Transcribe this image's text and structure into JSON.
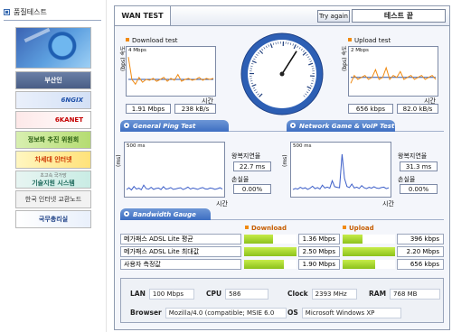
{
  "sidebar": {
    "heading": "품질테스트",
    "banners": {
      "busan": "부산인",
      "ngix": "6NGIX",
      "kanet": "6KANET",
      "info": "정보화 추진 위원회",
      "next": "차세대 인터넷",
      "kisti_sub": "초고속 국가망",
      "kisti": "기술지원 시스템",
      "kix": "한국 인터넷 교환노드",
      "pm": "국무총리실"
    }
  },
  "toolbar": {
    "title": "WAN TEST",
    "retry_label": "Try again",
    "status": "테스트 끝"
  },
  "download": {
    "label": "Download test",
    "yaxis": "(bps) 속도",
    "scale": "4 Mbps",
    "xlabel": "시간",
    "bps": "1.91 Mbps",
    "kBs": "238 kB/s",
    "series": [
      3.7,
      1.4,
      0.9,
      1.6,
      1.1,
      1.4,
      1.3,
      1.5,
      1.2,
      1.4,
      1.6,
      1.2,
      1.5,
      1.3,
      1.9,
      1.2,
      1.4,
      1.5,
      1.3,
      1.4,
      1.6,
      1.3,
      1.5,
      1.4,
      1.5
    ]
  },
  "upload": {
    "label": "Upload test",
    "yaxis": "(bps) 속도",
    "scale": "2 Mbps",
    "xlabel": "시간",
    "bps": "656 kbps",
    "kBs": "82.0 kB/s",
    "series": [
      0.5,
      0.9,
      0.7,
      0.8,
      0.9,
      0.7,
      0.8,
      1.2,
      0.7,
      0.8,
      1.3,
      0.7,
      0.9,
      0.8,
      1.1,
      0.7,
      0.8,
      0.9,
      0.7,
      0.8,
      0.9,
      0.7,
      0.8,
      0.9,
      0.7
    ]
  },
  "dial": {
    "needle_value": 0.62
  },
  "ping": {
    "tab": "General Ping Test",
    "yaxis": "(ms)",
    "scale": "500 ms",
    "xlabel": "시간",
    "rtt_label": "왕복지연율",
    "rtt_value": "22.7 ms",
    "loss_label": "손실율",
    "loss_value": "0.00%",
    "series": [
      20,
      28,
      18,
      34,
      22,
      26,
      19,
      40,
      24,
      22,
      30,
      21,
      25,
      27,
      20,
      33,
      22,
      24,
      29,
      21,
      23,
      26,
      28,
      20,
      25,
      31,
      22,
      27,
      24,
      21,
      26,
      29,
      23,
      22,
      27,
      25,
      21,
      24,
      28,
      22
    ]
  },
  "game": {
    "tab": "Network Game & VoIP Test",
    "yaxis": "(ms)",
    "scale": "500 ms",
    "xlabel": "시간",
    "rtt_label": "왕복지연율",
    "rtt_value": "31.3 ms",
    "loss_label": "손실율",
    "loss_value": "0.00%",
    "series": [
      20,
      25,
      22,
      30,
      24,
      28,
      21,
      26,
      35,
      24,
      29,
      22,
      40,
      27,
      31,
      26,
      60,
      33,
      30,
      28,
      180,
      70,
      34,
      29,
      45,
      27,
      31,
      25,
      38,
      28,
      24,
      30,
      26,
      33,
      27,
      25,
      29,
      31,
      24,
      28
    ]
  },
  "bandwidth": {
    "tab": "Bandwidth Gauge",
    "download_label": "Download",
    "upload_label": "Upload",
    "rows": [
      {
        "name": "메가패스 ADSL Lite 평균",
        "down": "1.36 Mbps",
        "down_frac": 0.55,
        "up": "396 kbps",
        "up_frac": 0.38
      },
      {
        "name": "메가패스 ADSL Lite 최대값",
        "down": "2.50 Mbps",
        "down_frac": 1.0,
        "up": "2.20 Mbps",
        "up_frac": 1.0
      },
      {
        "name": "사용자 측정값",
        "down": "1.90 Mbps",
        "down_frac": 0.76,
        "up": "656 kbps",
        "up_frac": 0.62
      }
    ]
  },
  "system": {
    "lan_key": "LAN",
    "lan_val": "100 Mbps",
    "cpu_key": "CPU",
    "cpu_val": "586",
    "clock_key": "Clock",
    "clock_val": "2393 MHz",
    "ram_key": "RAM",
    "ram_val": "768 MB",
    "browser_key": "Browser",
    "browser_val": "Mozilla/4.0 (compatible; MSIE 6.0",
    "os_key": "OS",
    "os_val": "Microsoft Windows XP"
  },
  "colors": {
    "download_line": "#f08a12",
    "upload_line": "#f08a12",
    "base_line": "#2e56a8",
    "ping_line": "#3c5ec8",
    "bar_fill": "#9ccf24"
  }
}
